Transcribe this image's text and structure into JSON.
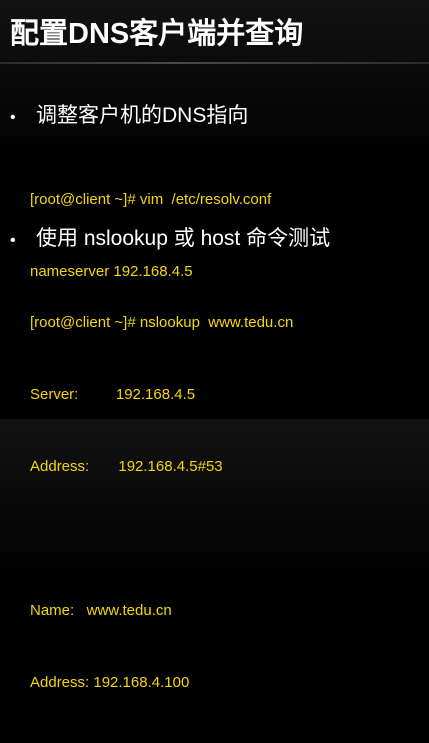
{
  "title": "配置DNS客户端并查询",
  "bullets": [
    {
      "marker": "•",
      "text": "调整客户机的DNS指向",
      "code": [
        "[root@client ~]# vim  /etc/resolv.conf",
        "nameserver 192.168.4.5"
      ]
    },
    {
      "marker": "•",
      "text": "使用 nslookup 或 host 命令测试",
      "code": [
        "[root@client ~]# nslookup  www.tedu.cn",
        "Server:         192.168.4.5",
        "Address:       192.168.4.5#53",
        "",
        "Name:   www.tedu.cn",
        "Address: 192.168.4.100"
      ]
    }
  ],
  "colors": {
    "background": "#000000",
    "title": "#ffffff",
    "bullet_text": "#ffffff",
    "code_text": "#f5d60a"
  }
}
